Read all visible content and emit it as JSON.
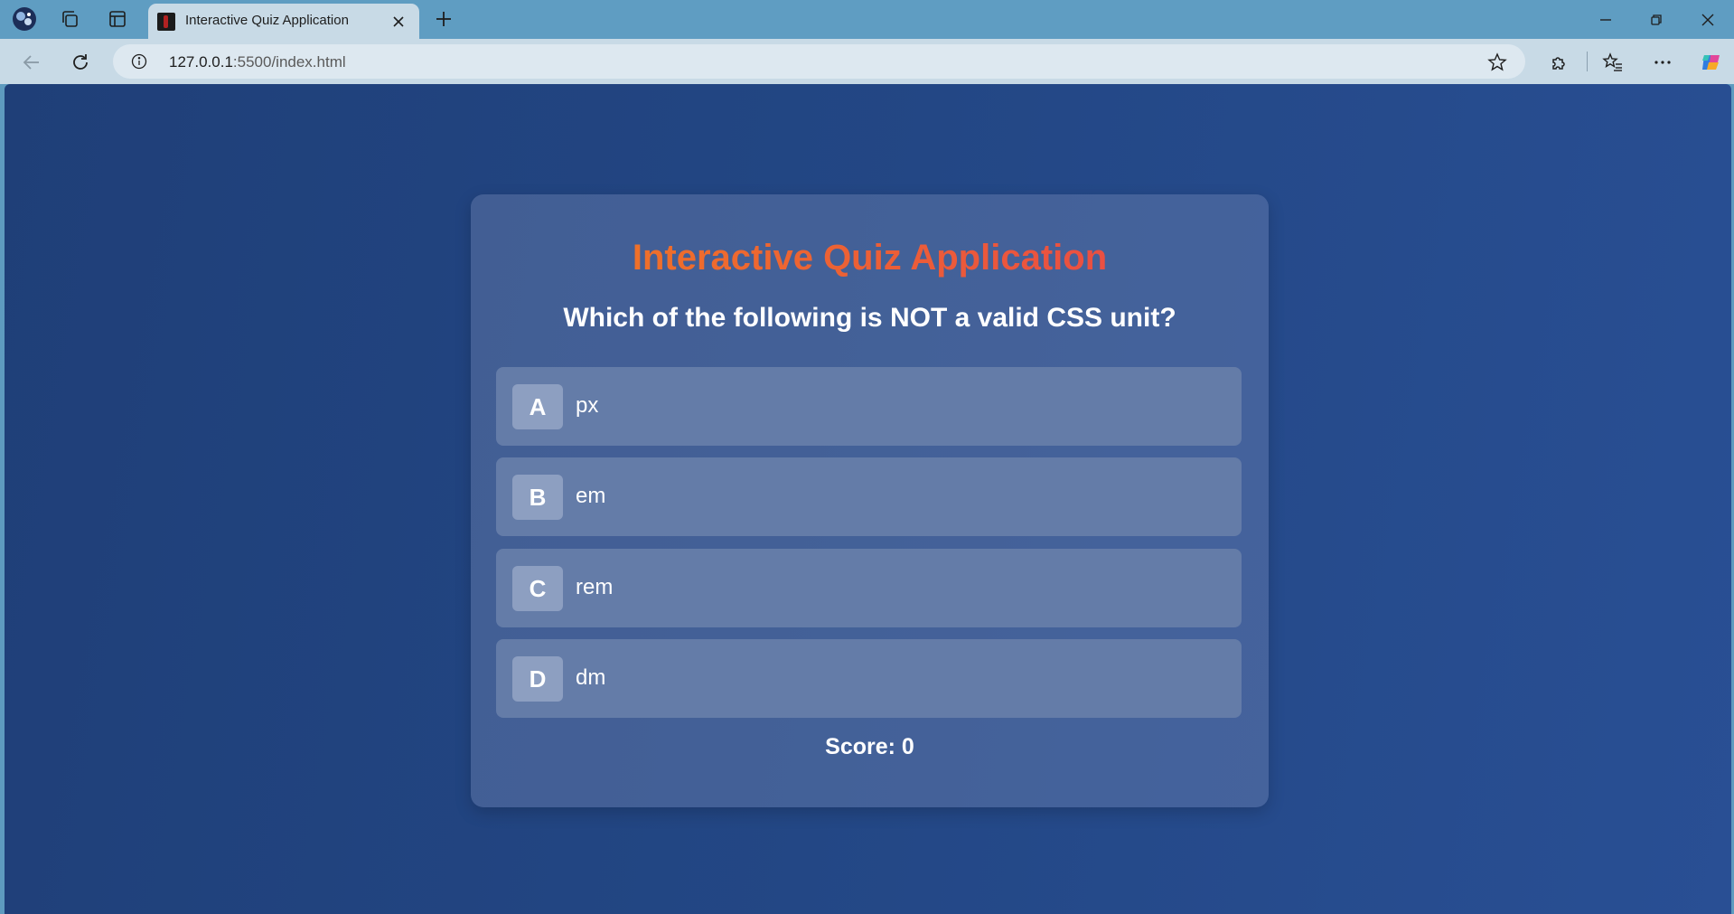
{
  "browser": {
    "tab_title": "Interactive Quiz Application",
    "url_host": "127.0.0.1",
    "url_rest": ":5500/index.html",
    "icons": [
      "profile-avatar-icon",
      "collections-icon",
      "tab-actions-icon",
      "close-icon",
      "new-tab-icon",
      "minimize-icon",
      "restore-icon",
      "window-close-icon",
      "back-icon",
      "refresh-icon",
      "site-info-icon",
      "favorite-star-icon",
      "extensions-icon",
      "favorites-icon",
      "more-icon",
      "copilot-icon"
    ]
  },
  "quiz": {
    "title": "Interactive Quiz Application",
    "question": "Which of the following is NOT a valid CSS unit?",
    "options": [
      {
        "letter": "A",
        "text": "px"
      },
      {
        "letter": "B",
        "text": "em"
      },
      {
        "letter": "C",
        "text": "rem"
      },
      {
        "letter": "D",
        "text": "dm"
      }
    ],
    "score_text": "Score: 0"
  },
  "colors": {
    "title_gradient_start": "#f07b22",
    "title_gradient_end": "#e8444a",
    "background": "#234785",
    "option_bg": "#647ca8"
  }
}
